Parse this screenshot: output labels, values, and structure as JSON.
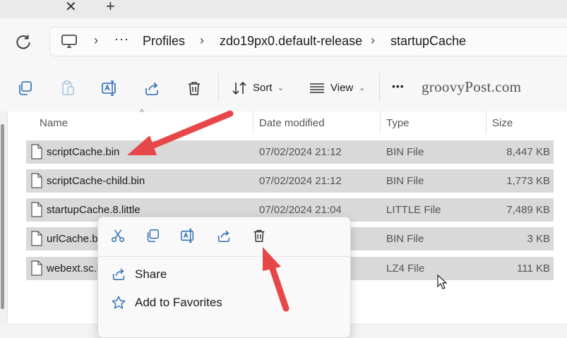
{
  "tabstrip": {
    "close_glyph": "✕",
    "new_glyph": "+"
  },
  "address": {
    "ellipsis": "···",
    "crumbs": [
      "Profiles",
      "zdo19px0.default-release",
      "startupCache"
    ]
  },
  "toolbar": {
    "sort_label": "Sort",
    "view_label": "View",
    "more_glyph": "•••"
  },
  "watermark": "groovyPost.com",
  "columns": [
    "Name",
    "Date modified",
    "Type",
    "Size"
  ],
  "files": [
    {
      "name": "scriptCache.bin",
      "date": "07/02/2024 21:12",
      "type": "BIN File",
      "size": "8,447 KB"
    },
    {
      "name": "scriptCache-child.bin",
      "date": "07/02/2024 21:12",
      "type": "BIN File",
      "size": "1,773 KB"
    },
    {
      "name": "startupCache.8.little",
      "date": "07/02/2024 21:04",
      "type": "LITTLE File",
      "size": "7,489 KB"
    },
    {
      "name": "urlCache.b",
      "date": "",
      "type": "BIN File",
      "size": "3 KB"
    },
    {
      "name": "webext.sc.l",
      "date": "",
      "type": "LZ4 File",
      "size": "111 KB"
    }
  ],
  "context_menu": {
    "items": [
      "Share",
      "Add to Favorites"
    ]
  },
  "colors": {
    "arrow": "#e8474a",
    "selection": "#d9d9d9",
    "accent": "#2b6cb0"
  }
}
